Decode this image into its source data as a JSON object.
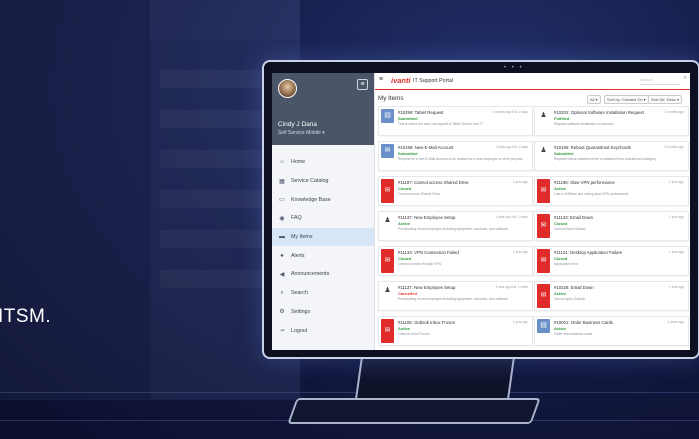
{
  "tagline": "ITSM.",
  "monitor": {
    "camera_dots": "• • •"
  },
  "sidebar": {
    "user_name": "Cindy J Dana",
    "user_role": "Self Service Mobile ▾",
    "items": [
      {
        "label": "Home",
        "icon": "home-icon",
        "glyph": "⌂"
      },
      {
        "label": "Service Catalog",
        "icon": "catalog-icon",
        "glyph": "▦"
      },
      {
        "label": "Knowledge Base",
        "icon": "book-icon",
        "glyph": "▭"
      },
      {
        "label": "FAQ",
        "icon": "faq-icon",
        "glyph": "◉"
      },
      {
        "label": "My Items",
        "icon": "folder-icon",
        "glyph": "▬"
      },
      {
        "label": "Alerts",
        "icon": "bell-icon",
        "glyph": "♠"
      },
      {
        "label": "Announcements",
        "icon": "megaphone-icon",
        "glyph": "◀"
      },
      {
        "label": "Search",
        "icon": "search-icon",
        "glyph": "⌕"
      },
      {
        "label": "Settings",
        "icon": "gear-icon",
        "glyph": "⚙"
      },
      {
        "label": "Logout",
        "icon": "logout-icon",
        "glyph": "⊸"
      }
    ]
  },
  "topbar": {
    "brand": "ivanti",
    "portal_title": "IT Support Portal",
    "search_placeholder": "Search"
  },
  "page": {
    "title": "My Items",
    "filter_all": "All ▾",
    "sort_by": "Sort by: Created On ▾",
    "sort_dir": "Sort Dir: Desc ▾"
  },
  "colors": {
    "accent": "#e03030",
    "submitted": "#2e9a3a",
    "closed": "#2e9a3a",
    "cancelled": "#e03030",
    "active": "#2e9a3a"
  },
  "cards": [
    {
      "title": "#10298: Tablet Request",
      "status": "Submitted",
      "status_kind": "submitted",
      "desc": "This is where the user can request a Tablet Device from IT",
      "meta": "2 months ago  Est: 2 days",
      "icon": "tablet-icon",
      "kind": "doc",
      "glyph": "▤"
    },
    {
      "title": "#10202: Optional Software Installation Request",
      "status": "Fulfilled",
      "status_kind": "closed",
      "desc": "Request software installation on account",
      "meta": "2 months ago",
      "icon": "person-icon",
      "kind": "person",
      "glyph": "♟"
    },
    {
      "title": "#10199: New E-Mail Account",
      "status": "Submitted",
      "status_kind": "submitted",
      "desc": "Request for a new E-Mail Account to be created for a new employee or other purpose",
      "meta": "2 days ago  Est: 2 days",
      "icon": "envelope-icon",
      "kind": "doc",
      "glyph": "✉"
    },
    {
      "title": "#10196: Reboot Quarantined Keychords",
      "status": "Submitted",
      "status_kind": "submitted",
      "desc": "Request that an attachment be re-attached from quarantined category",
      "meta": "6 months ago",
      "icon": "person-icon",
      "kind": "person",
      "glyph": "♟"
    },
    {
      "title": "#11197: Cannot access Shared Drive",
      "status": "Closed",
      "status_kind": "closed",
      "desc": "Cannot access Shared Drive",
      "meta": "1 year ago",
      "icon": "mail-icon",
      "kind": "mail",
      "glyph": "✉"
    },
    {
      "title": "#11195: Slow VPN performance",
      "status": "Active",
      "status_kind": "active",
      "desc": "I am a VMWare and seeing slow VPN performance",
      "meta": "1 year ago",
      "icon": "mail-icon",
      "kind": "mail",
      "glyph": "✉"
    },
    {
      "title": "#11137: New Employee Setup",
      "status": "Active",
      "status_kind": "active",
      "desc": "Provisioning of new employee including equipment, accounts, and software",
      "meta": "1 year ago  Est: 1 week",
      "icon": "person-icon",
      "kind": "person",
      "glyph": "♟"
    },
    {
      "title": "#11133: Email Down",
      "status": "Closed",
      "status_kind": "closed",
      "desc": "Cannot Open Outlook",
      "meta": "1 year ago",
      "icon": "mail-icon",
      "kind": "mail",
      "glyph": "✉"
    },
    {
      "title": "#11133: VPN Connection Failed",
      "status": "Closed",
      "status_kind": "closed",
      "desc": "Cannot connect through VPN",
      "meta": "1 year ago",
      "icon": "mail-icon",
      "kind": "mail",
      "glyph": "✉"
    },
    {
      "title": "#11131: Desktop Application Failure",
      "status": "Closed",
      "status_kind": "closed",
      "desc": "Application Error",
      "meta": "1 year ago",
      "icon": "mail-icon",
      "kind": "mail",
      "glyph": "✉"
    },
    {
      "title": "#11137: New Employee Setup",
      "status": "Cancelled",
      "status_kind": "cancelled",
      "desc": "Provisioning of new employee including equipment, accounts, and software",
      "meta": "1 year ago  Est: 1 week",
      "icon": "person-icon",
      "kind": "person",
      "glyph": "♟"
    },
    {
      "title": "#10328: Email Down",
      "status": "Active",
      "status_kind": "active",
      "desc": "Cannot open Outlook",
      "meta": "1 year ago",
      "icon": "mail-icon",
      "kind": "mail",
      "glyph": "✉"
    },
    {
      "title": "#11106: Outlook Inbox Frozen",
      "status": "Active",
      "status_kind": "active",
      "desc": "Outlook Inbox Frozen",
      "meta": "1 year ago",
      "icon": "mail-icon",
      "kind": "mail",
      "glyph": "✉"
    },
    {
      "title": "#10001: Order Business Cards",
      "status": "Active",
      "status_kind": "active",
      "desc": "Order new business cards",
      "meta": "2 years ago",
      "icon": "card-icon",
      "kind": "doc",
      "glyph": "▤"
    }
  ]
}
